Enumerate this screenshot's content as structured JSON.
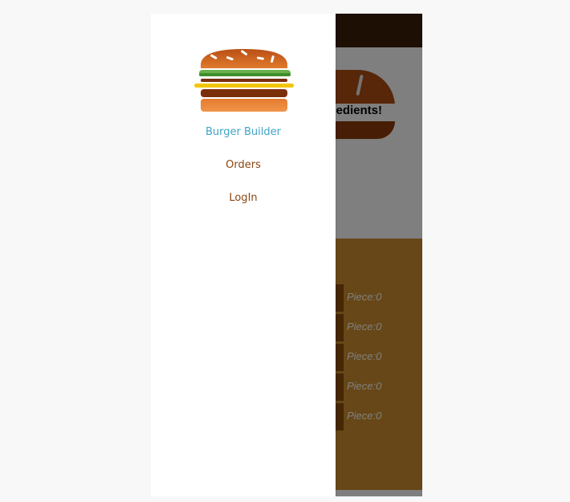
{
  "app": {
    "burger_message": "edients!",
    "controls": [
      {
        "piece": "Piece:0"
      },
      {
        "piece": "Piece:0"
      },
      {
        "piece": "Piece:0"
      },
      {
        "piece": "Piece:0"
      },
      {
        "piece": "Piece:0"
      }
    ]
  },
  "drawer": {
    "logo_icon": "burger-icon",
    "nav": [
      {
        "label": "Burger Builder",
        "active": true
      },
      {
        "label": "Orders",
        "active": false
      },
      {
        "label": "LogIn",
        "active": false
      }
    ]
  },
  "colors": {
    "toolbar": "#3d1f0a",
    "controls_bg": "#cf8f2e",
    "nav_active": "#40a4c8",
    "nav_inactive": "#8b4513"
  }
}
